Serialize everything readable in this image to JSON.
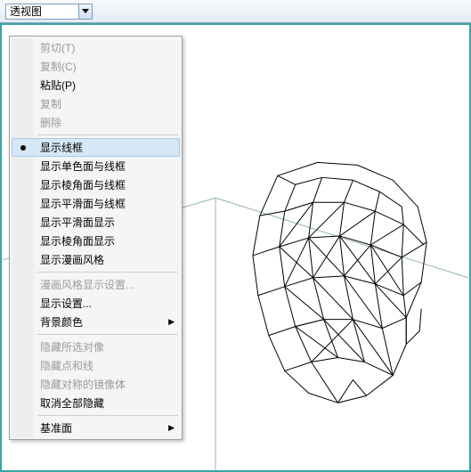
{
  "titlebar": {
    "view_dropdown_label": "透视图"
  },
  "context_menu": {
    "items": [
      {
        "label": "剪切(T)",
        "enabled": false
      },
      {
        "label": "复制(C)",
        "enabled": false
      },
      {
        "label": "粘贴(P)",
        "enabled": true
      },
      {
        "label": "复制",
        "enabled": false
      },
      {
        "label": "删除",
        "enabled": false
      },
      {
        "sep": true
      },
      {
        "label": "显示线框",
        "enabled": true,
        "checked": true,
        "highlight": true
      },
      {
        "label": "显示单色面与线框",
        "enabled": true
      },
      {
        "label": "显示棱角面与线框",
        "enabled": true
      },
      {
        "label": "显示平滑面与线框",
        "enabled": true
      },
      {
        "label": "显示平滑面显示",
        "enabled": true
      },
      {
        "label": "显示棱角面显示",
        "enabled": true
      },
      {
        "label": "显示漫画风格",
        "enabled": true
      },
      {
        "sep": true
      },
      {
        "label": "漫画风格显示设置...",
        "enabled": false
      },
      {
        "label": "显示设置...",
        "enabled": true
      },
      {
        "label": "背景颜色",
        "enabled": true,
        "submenu": true
      },
      {
        "sep": true
      },
      {
        "label": "隐藏所选对像",
        "enabled": false
      },
      {
        "label": "隐藏点和线",
        "enabled": false
      },
      {
        "label": "隐藏对称的镜像体",
        "enabled": false
      },
      {
        "label": "取消全部隐藏",
        "enabled": true
      },
      {
        "sep": true
      },
      {
        "label": "基准面",
        "enabled": true,
        "submenu": true
      }
    ]
  },
  "icons": {
    "chevron_down": "chevron-down-icon",
    "submenu_arrow": "▶"
  }
}
